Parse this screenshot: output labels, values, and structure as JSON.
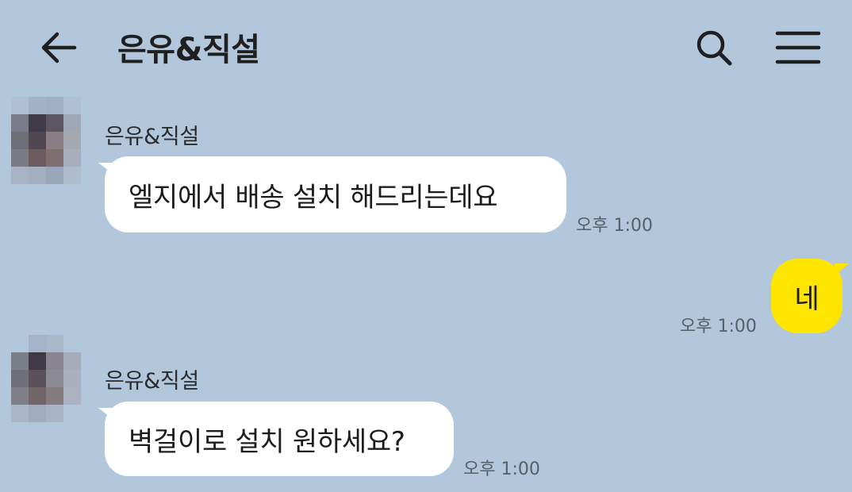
{
  "header": {
    "title": "은유&직설",
    "back_icon": "arrow-left-icon",
    "search_icon": "search-icon",
    "menu_icon": "hamburger-menu-icon"
  },
  "messages": [
    {
      "sender": "은유&직설",
      "text": "엘지에서 배송 설치 해드리는데요",
      "time": "오후 1:00",
      "direction": "incoming"
    },
    {
      "sender": "",
      "text": "네",
      "time": "오후 1:00",
      "direction": "outgoing"
    },
    {
      "sender": "은유&직설",
      "text": "벽걸이로 설치 원하세요?",
      "time": "오후 1:00",
      "direction": "incoming"
    }
  ],
  "colors": {
    "background": "#b3c7dc",
    "incoming_bubble": "#ffffff",
    "outgoing_bubble": "#fee500"
  }
}
